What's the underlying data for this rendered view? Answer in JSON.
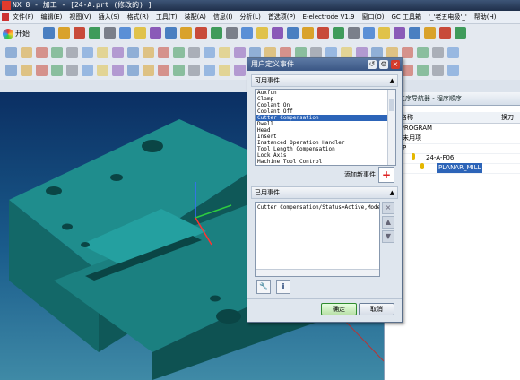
{
  "title_bar": {
    "text": "NX 8 - 加工 - [24-A.prt  (修改的) ]"
  },
  "menu": [
    "文件(F)",
    "编辑(E)",
    "视图(V)",
    "插入(S)",
    "格式(R)",
    "工具(T)",
    "装配(A)",
    "信息(I)",
    "分析(L)",
    "首选项(P)",
    "E-electrode V1.9",
    "窗口(O)",
    "GC 工具箱",
    "'_'老五电极'_'",
    "帮助(H)"
  ],
  "toolbar": {
    "start_label": "开始"
  },
  "navigator": {
    "header": "工序导航器 - 程序顺序",
    "col_name": "名称",
    "col_tool": "换刀",
    "rows": [
      {
        "label": "NC_PROGRAM"
      },
      {
        "label": "未用项"
      },
      {
        "label": "P"
      },
      {
        "label": "24-A-F06"
      },
      {
        "label": "PLANAR_MILL"
      }
    ]
  },
  "dialog": {
    "title": "用户定义事件",
    "available_section": "可用事件",
    "available_events": [
      "Auxfun",
      "Clamp",
      "Coolant On",
      "Coolant Off",
      "Cutter Compensation",
      "Dwell",
      "Head",
      "Insert",
      "Instanced Operation Handler",
      "Tool Length Compensation",
      "Lock Axis",
      "Machine Tool Control"
    ],
    "selected_event": "Cutter Compensation",
    "add_label": "添加新事件",
    "used_section": "已用事件",
    "used_value": "Cutter Compensation/Status=Active,Mode",
    "ok_label": "确定",
    "cancel_label": "取消"
  }
}
